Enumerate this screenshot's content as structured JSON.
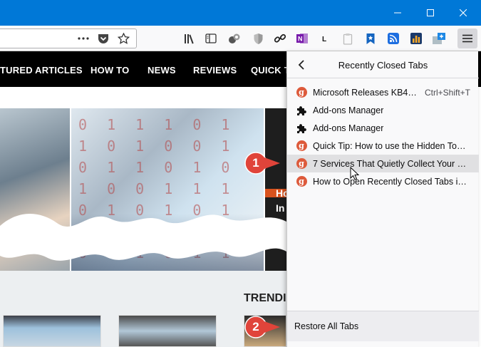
{
  "window": {
    "minimize_icon": "minimize-icon",
    "maximize_icon": "maximize-icon",
    "close_icon": "close-icon"
  },
  "toolbar": {
    "icons": [
      "page-actions-icon",
      "pocket-icon",
      "bookmark-star-icon",
      "library-icon",
      "sidebar-icon",
      "extension-icon",
      "shield-icon",
      "link-icon",
      "onenote-icon",
      "lastpass-icon",
      "clipboard-icon",
      "bookmark-icon",
      "rss-icon",
      "stats-icon",
      "screenshot-icon",
      "hamburger-menu-icon"
    ]
  },
  "site": {
    "nav": [
      "TURED ARTICLES",
      "HOW TO",
      "NEWS",
      "REVIEWS",
      "QUICK T"
    ],
    "binary_text": "0 1 1 1 0 1\n1 0 1 0 0 1\n0 1 1 0 1 0\n1 0 0 1 1 1\n0 1 0 1 0 1\n1 1 0 0 1 0\n0 1 1 0 1 1",
    "hero_text_1": "Ho",
    "hero_text_2": "In",
    "trending": "TRENDI"
  },
  "panel": {
    "title": "Recently Closed Tabs",
    "items": [
      {
        "label": "Microsoft Releases KB405...",
        "icon": "g",
        "shortcut": "Ctrl+Shift+T"
      },
      {
        "label": "Add-ons Manager",
        "icon": "puzzle"
      },
      {
        "label": "Add-ons Manager",
        "icon": "puzzle"
      },
      {
        "label": "Quick Tip: How to use the Hidden Touc...",
        "icon": "g"
      },
      {
        "label": "7 Services That Quietly Collect Your Per...",
        "icon": "g"
      },
      {
        "label": "How to Open Recently Closed Tabs in S...",
        "icon": "g"
      }
    ],
    "restore_label": "Restore All Tabs"
  },
  "callouts": [
    "1",
    "2"
  ],
  "colors": {
    "titlebar": "#0078d7",
    "callout": "#e0443a",
    "favicon": "#dd5a3b"
  }
}
